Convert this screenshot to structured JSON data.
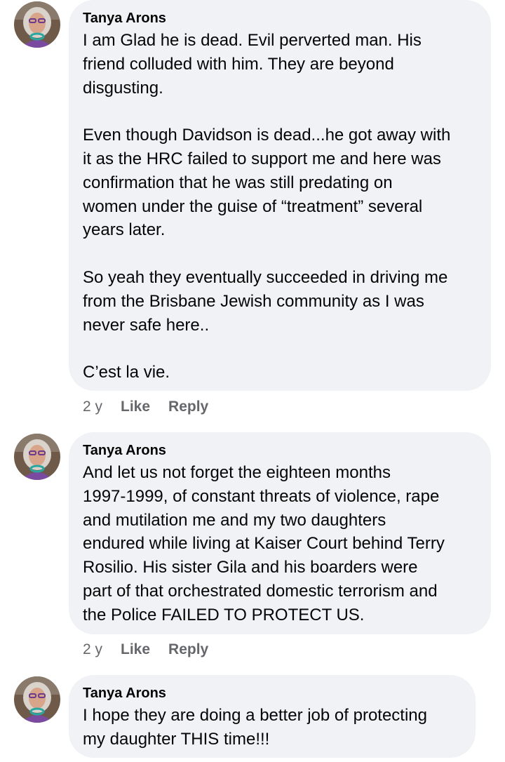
{
  "colors": {
    "bubble_bg": "#f0f2f5",
    "text": "#050505",
    "meta": "#65676b"
  },
  "comments": [
    {
      "author": "Tanya Arons",
      "paragraphs": [
        "I am Glad he is dead.  Evil perverted man.  His\nfriend colluded with him.  They are beyond\ndisgusting.",
        "Even though Davidson is dead...he got away with\nit as the HRC failed to support me and here was\nconfirmation that he was still predating on\nwomen under the guise of “treatment” several\nyears later.",
        "So yeah they eventually succeeded in driving me\nfrom the Brisbane Jewish community as I was\nnever safe here..",
        "C’est la vie."
      ],
      "time": "2 y",
      "like": "Like",
      "reply": "Reply",
      "avatar_icon": "profile-photo"
    },
    {
      "author": "Tanya Arons",
      "paragraphs": [
        "And let us not forget the eighteen months\n1997-1999, of constant threats of violence, rape\nand mutilation me and my two daughters\nendured while living at Kaiser Court behind Terry\nRosilio.  His sister Gila and his boarders were\npart of that orchestrated domestic terrorism and\nthe Police FAILED TO PROTECT US."
      ],
      "time": "2 y",
      "like": "Like",
      "reply": "Reply",
      "avatar_icon": "profile-photo"
    },
    {
      "author": "Tanya Arons",
      "paragraphs": [
        "I hope they are doing a better job of protecting\nmy daughter THIS time!!!"
      ],
      "avatar_icon": "profile-photo"
    }
  ]
}
